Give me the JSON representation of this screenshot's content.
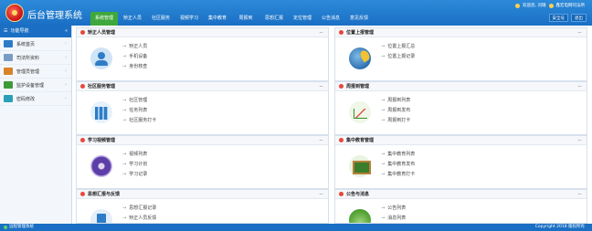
{
  "app": {
    "title": "后台管理系统"
  },
  "nav": {
    "items": [
      "系统管理",
      "矫正人员",
      "社区服务",
      "视频学习",
      "集中教育",
      "周报到",
      "思想汇报",
      "定位管理",
      "公告消息",
      "意见反馈"
    ],
    "active": "系统管理"
  },
  "topbar": {
    "welcome": "欢迎您, 刘璐",
    "org": "鑫宏电网司法所",
    "buttons": [
      "安全号",
      "退出"
    ]
  },
  "sidebar": {
    "header": "功能导航",
    "items": [
      {
        "label": "系统首页",
        "color": "#2e7cc6"
      },
      {
        "label": "司法所资料",
        "color": "#7a9cc4"
      },
      {
        "label": "管理员管理",
        "color": "#d9822b"
      },
      {
        "label": "监护设备管理",
        "color": "#3f9a3a"
      },
      {
        "label": "密码修改",
        "color": "#2aa0b8"
      }
    ]
  },
  "panels": [
    {
      "title": "矫正人员管理",
      "icon": "person-icon",
      "links": [
        "矫正人员",
        "手机设备",
        "身份核查"
      ]
    },
    {
      "title": "位置上报管理",
      "icon": "globe-location-icon",
      "links": [
        "位置上报汇总",
        "位置上报记录"
      ]
    },
    {
      "title": "社区服务管理",
      "icon": "building-icon",
      "links": [
        "社区管理",
        "任务列表",
        "社区服务打卡"
      ]
    },
    {
      "title": "周报到管理",
      "icon": "chart-icon",
      "links": [
        "周报到列表",
        "周报到发布",
        "周报到打卡"
      ]
    },
    {
      "title": "学习视频管理",
      "icon": "disc-icon",
      "links": [
        "视频列表",
        "学习计划",
        "学习记录"
      ]
    },
    {
      "title": "集中教育管理",
      "icon": "blackboard-icon",
      "links": [
        "集中教育列表",
        "集中教育发布",
        "集中教育打卡"
      ]
    },
    {
      "title": "思想汇报与反馈",
      "icon": "document-icon",
      "links": [
        "思想汇报记录",
        "矫正人员反馈"
      ]
    },
    {
      "title": "公告与消息",
      "icon": "news-icon",
      "links": [
        "公告列表",
        "消息列表"
      ]
    }
  ],
  "panel_collapse_label": "－",
  "footer": {
    "left": "远程管理系统",
    "right": "Copyright 2018 版权所有"
  }
}
